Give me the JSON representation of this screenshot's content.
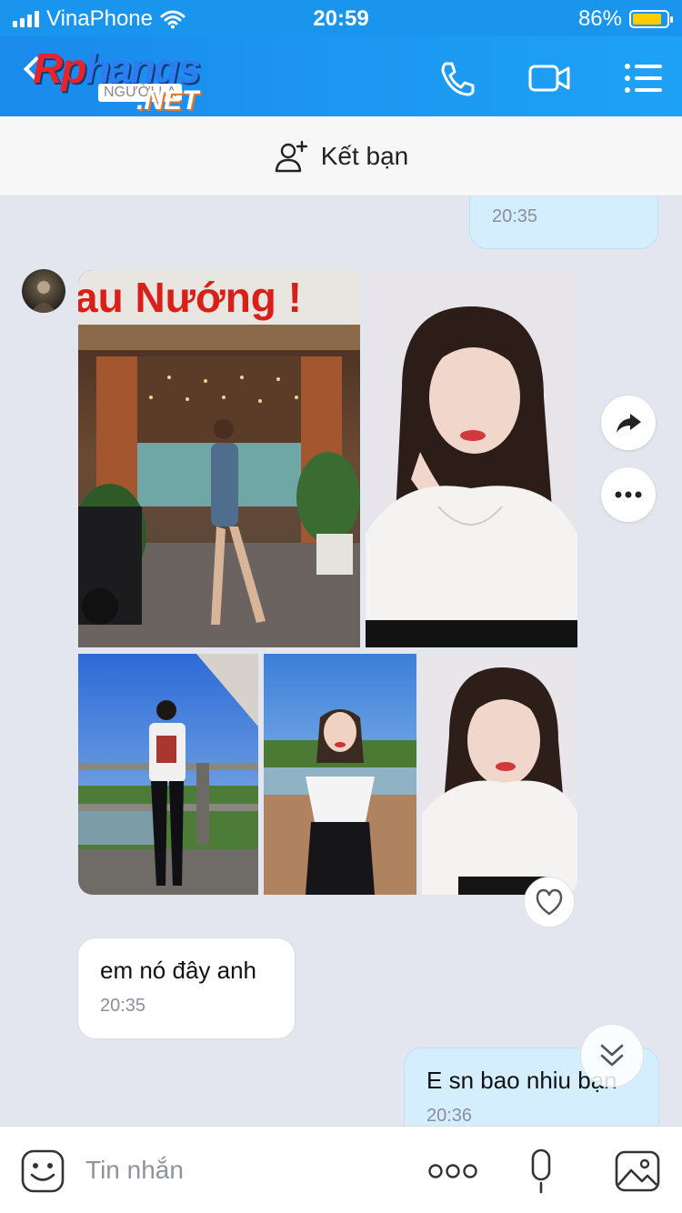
{
  "status_bar": {
    "carrier": "VinaPhone",
    "time": "20:59",
    "battery": "86%",
    "battery_level": 0.86
  },
  "nav": {
    "logo": {
      "line1": "Rp",
      "line1b": "hangs",
      "line2": "NGƯỜI LẠ",
      "line3": ".NET"
    },
    "icons": [
      "phone-icon",
      "video-call-icon",
      "menu-list-icon"
    ]
  },
  "add_friend": {
    "label": "Kết bạn",
    "icon": "add-user-icon"
  },
  "messages": [
    {
      "direction": "out",
      "text": "",
      "time": "20:35"
    },
    {
      "direction": "in",
      "type": "photo-album",
      "photos": 5,
      "sign_text": "au Nướng !"
    },
    {
      "direction": "in",
      "text": "em nó đây anh",
      "time": "20:35"
    },
    {
      "direction": "out",
      "text": "E sn bao nhiu bạn",
      "time": "20:36"
    }
  ],
  "actions": {
    "share_icon": "share-arrow-icon",
    "more_icon": "more-dots-icon",
    "react_icon": "heart-icon",
    "scroll_icon": "chevron-double-down-icon"
  },
  "composer": {
    "placeholder": "Tin nhắn",
    "icons": [
      "emoji-icon",
      "more-dots-icon",
      "microphone-icon",
      "image-icon"
    ]
  },
  "colors": {
    "header": "#1a95ee",
    "bubble_out": "#d5eefe",
    "background": "#e3e6ee"
  }
}
